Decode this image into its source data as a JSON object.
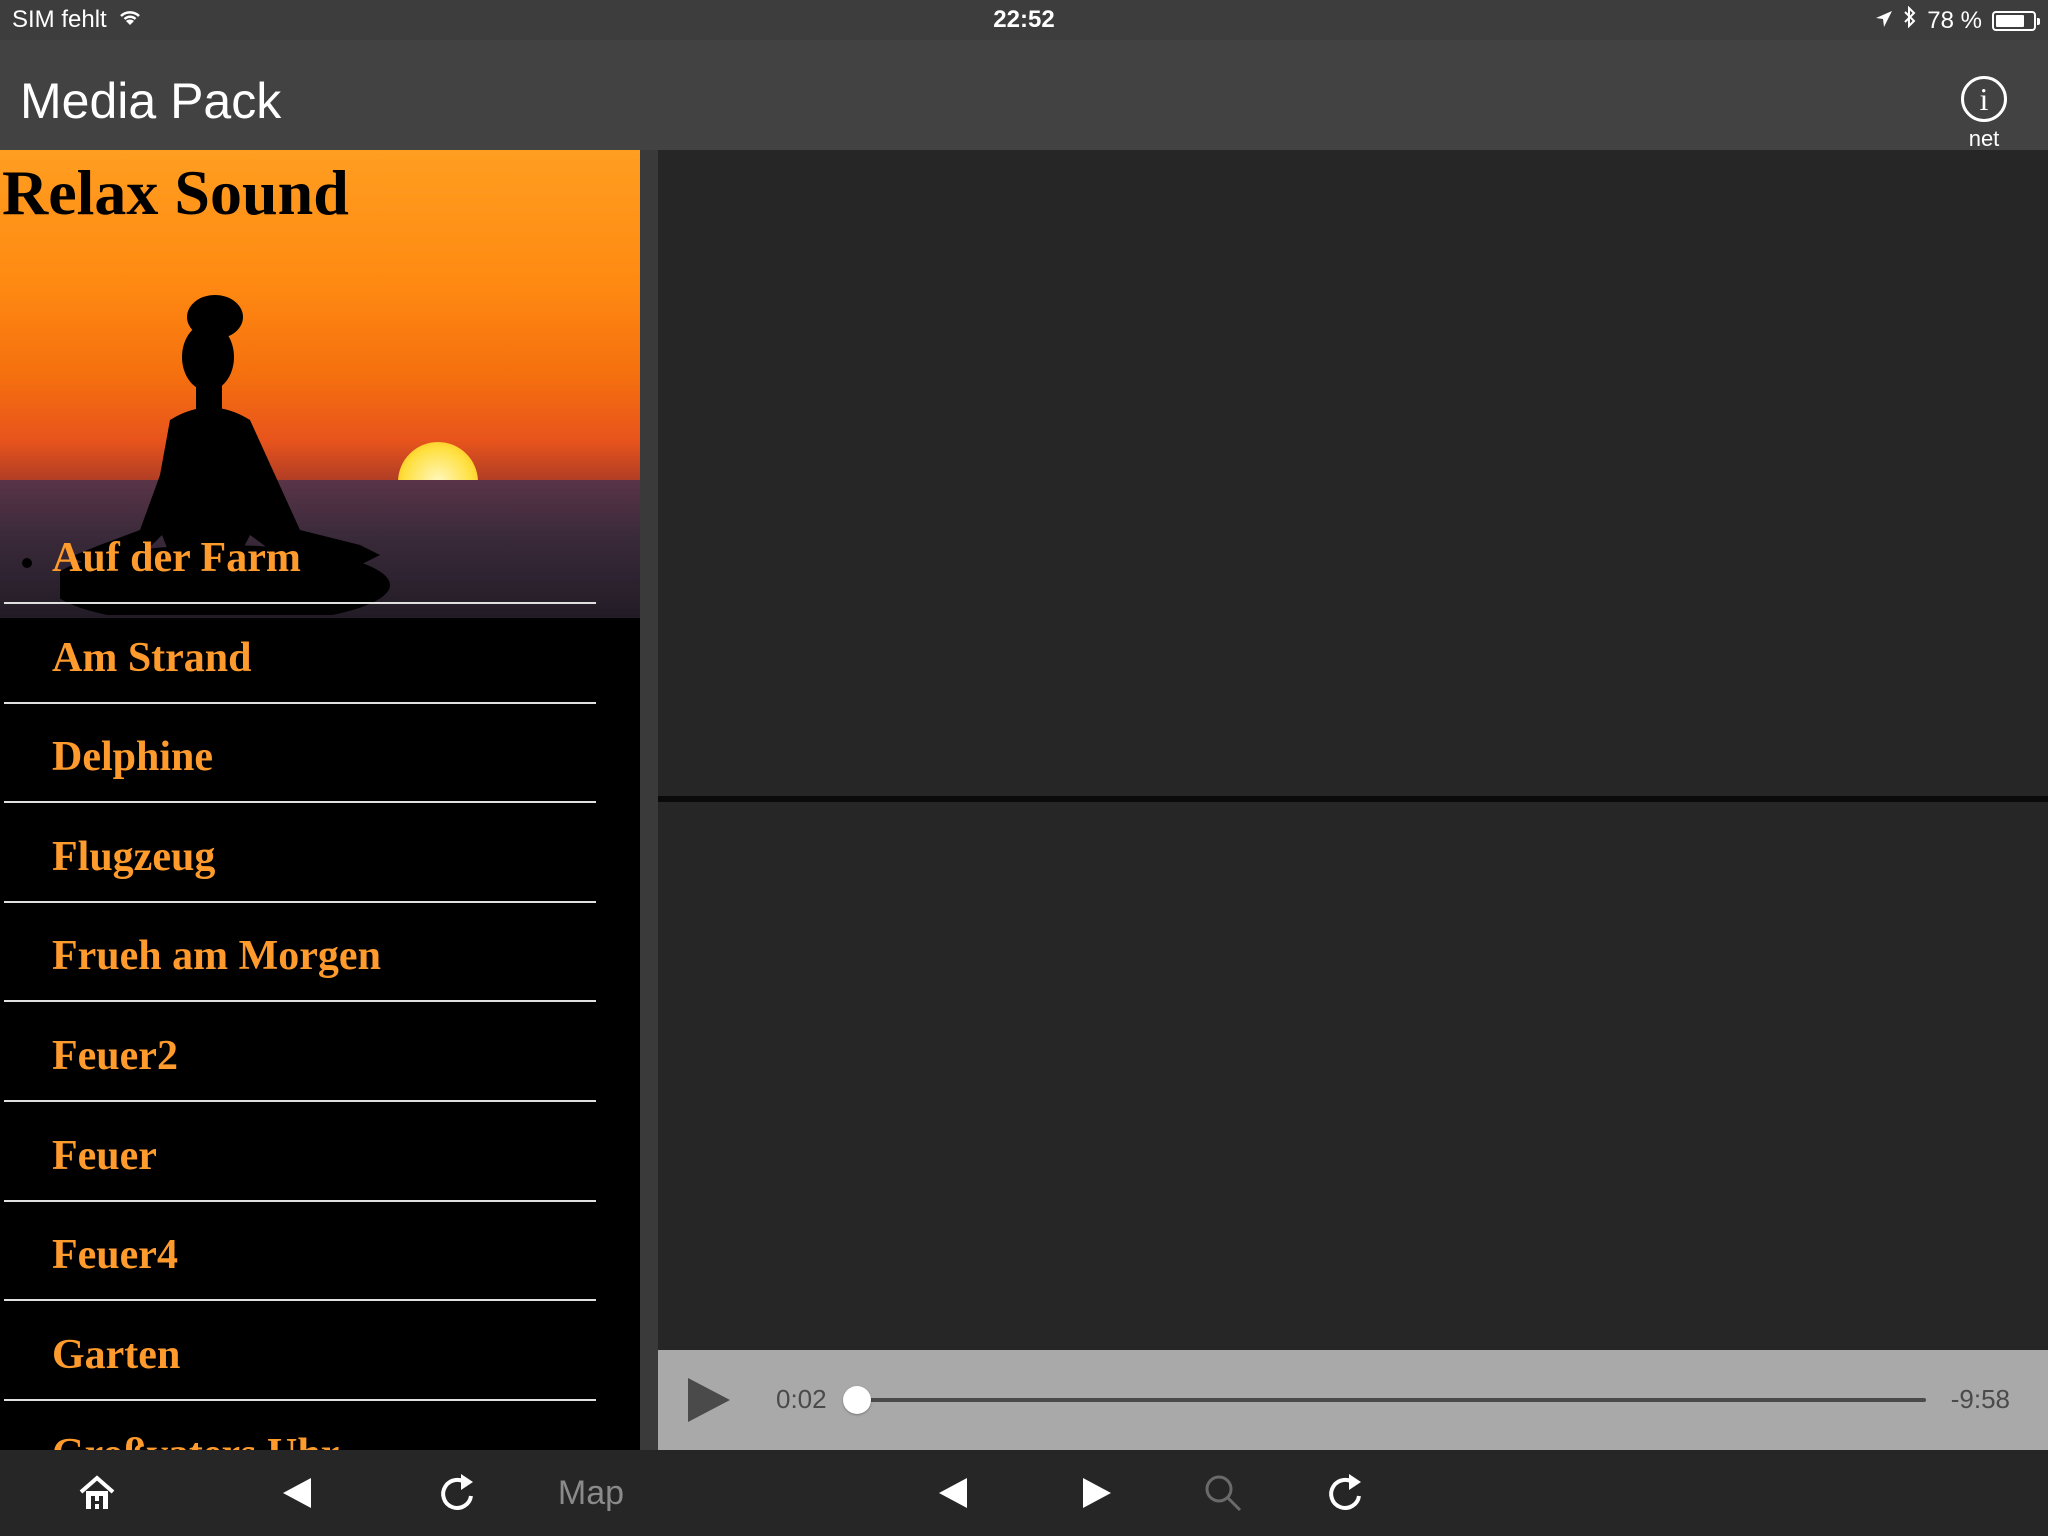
{
  "status_bar": {
    "carrier": "SIM fehlt",
    "time": "22:52",
    "battery_text": "78 %",
    "battery_level": 0.78
  },
  "nav": {
    "title": "Media Pack",
    "info_label": "net",
    "info_glyph": "i"
  },
  "panel": {
    "heading": "Relax Sound",
    "items": [
      {
        "label": "Auf der Farm"
      },
      {
        "label": "Am Strand"
      },
      {
        "label": "Delphine"
      },
      {
        "label": "Flugzeug"
      },
      {
        "label": "Frueh am Morgen"
      },
      {
        "label": "Feuer2"
      },
      {
        "label": "Feuer"
      },
      {
        "label": "Feuer4"
      },
      {
        "label": "Garten"
      },
      {
        "label": "Großvaters Uhr"
      }
    ]
  },
  "player": {
    "current_time": "0:02",
    "remaining_time": "-9:58",
    "progress": 0.003
  },
  "toolbar": {
    "map_label": "Map",
    "icons": [
      "home-icon",
      "back-arrow-icon",
      "reload-icon",
      "back-arrow-icon",
      "forward-arrow-icon",
      "search-icon",
      "reload-icon"
    ]
  },
  "colors": {
    "accent_orange": "#ff9a2c",
    "panel_bg": "#000000",
    "content_bg": "#262626",
    "player_bg": "#a9a9a9"
  }
}
